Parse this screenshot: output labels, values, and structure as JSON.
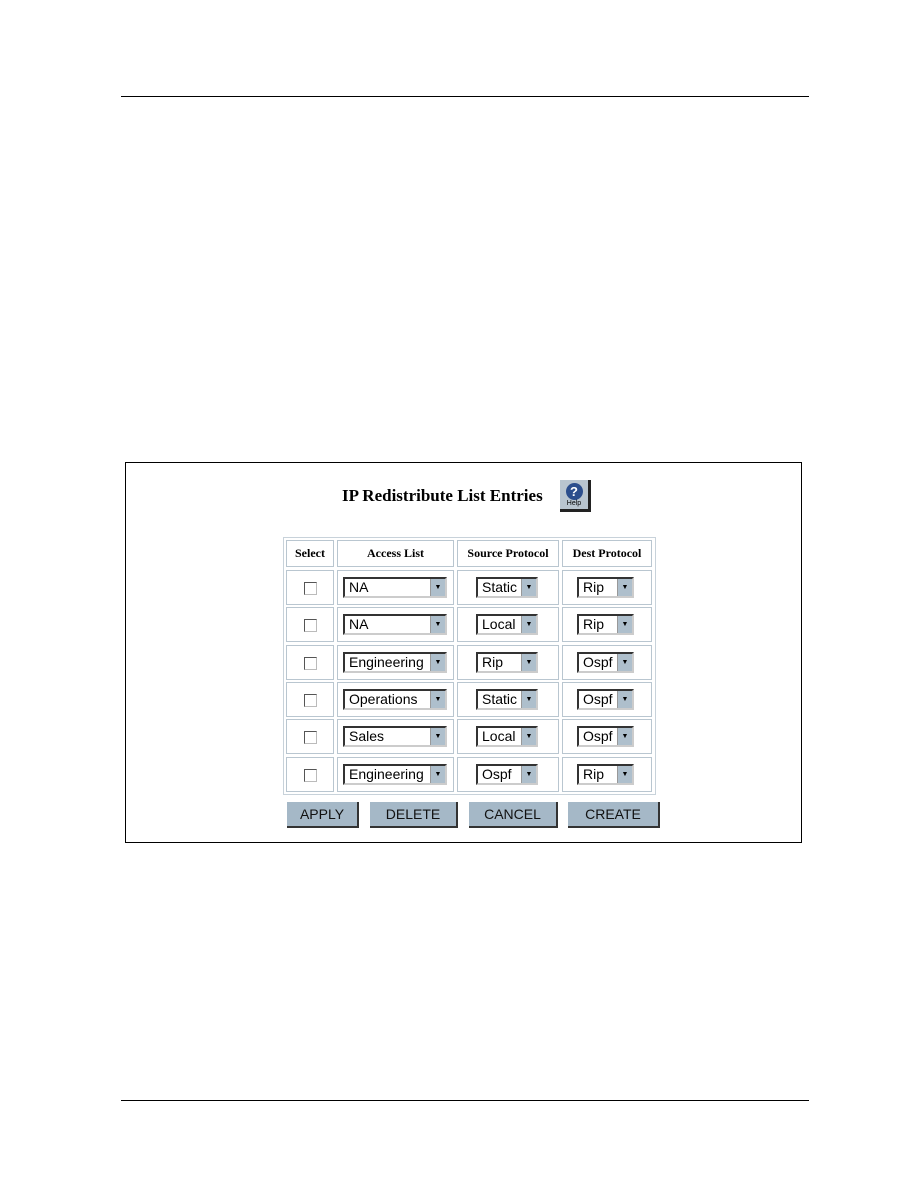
{
  "panel": {
    "title": "IP Redistribute List Entries",
    "help_label": "Help"
  },
  "table": {
    "headers": [
      "Select",
      "Access List",
      "Source Protocol",
      "Dest Protocol"
    ],
    "rows": [
      {
        "selected": false,
        "access_list": "NA",
        "source": "Static",
        "dest": "Rip"
      },
      {
        "selected": false,
        "access_list": "NA",
        "source": "Local",
        "dest": "Rip"
      },
      {
        "selected": false,
        "access_list": "Engineering",
        "source": "Rip",
        "dest": "Ospf"
      },
      {
        "selected": false,
        "access_list": "Operations",
        "source": "Static",
        "dest": "Ospf"
      },
      {
        "selected": false,
        "access_list": "Sales",
        "source": "Local",
        "dest": "Ospf"
      },
      {
        "selected": false,
        "access_list": "Engineering",
        "source": "Ospf",
        "dest": "Rip"
      }
    ]
  },
  "buttons": {
    "apply": "APPLY",
    "delete": "DELETE",
    "cancel": "CANCEL",
    "create": "CREATE"
  },
  "colors": {
    "button": "#a5b8c7",
    "help_icon": "#2c4e8c"
  }
}
